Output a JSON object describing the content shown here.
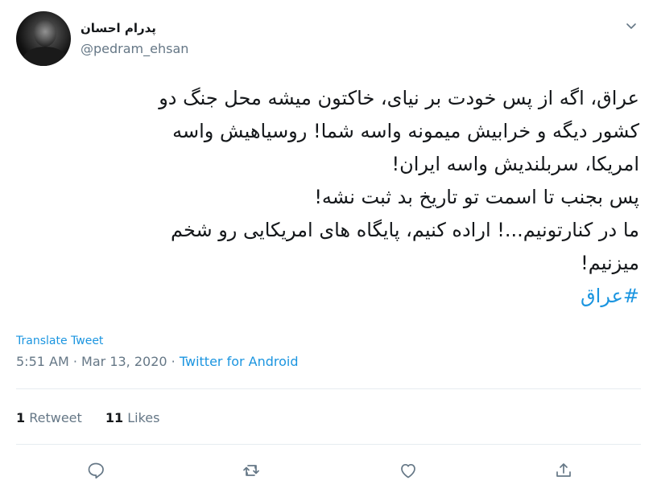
{
  "user": {
    "name": "پدرام احسان",
    "handle": "@pedram_ehsan"
  },
  "tweet": {
    "lines": [
      "عراق، اگه از پس خودت بر نیای، خاکتون میشه محل جنگ دو",
      "کشور دیگه و خرابیش میمونه واسه شما! روسیاهیش واسه",
      "امریکا، سربلندیش واسه ایران!",
      "پس بجنب تا اسمت تو تاریخ بد ثبت نشه!",
      "ما در کنارتونیم...! اراده کنیم، پایگاه های امریکایی رو شخم",
      "میزنیم!"
    ],
    "hashtag": "#عراق"
  },
  "translate_label": "Translate Tweet",
  "meta": {
    "time": "5:51 AM",
    "separator": "·",
    "date": "Mar 13, 2020",
    "source": "Twitter for Android"
  },
  "stats": {
    "retweets_count": "1",
    "retweets_label": "Retweet",
    "likes_count": "11",
    "likes_label": "Likes"
  },
  "actions": {
    "reply_icon": "reply-icon",
    "retweet_icon": "retweet-icon",
    "like_icon": "heart-icon",
    "share_icon": "share-icon"
  },
  "colors": {
    "accent": "#1b95e0",
    "secondary_text": "#657786",
    "primary_text": "#14171a",
    "divider": "#e6ecf0"
  }
}
